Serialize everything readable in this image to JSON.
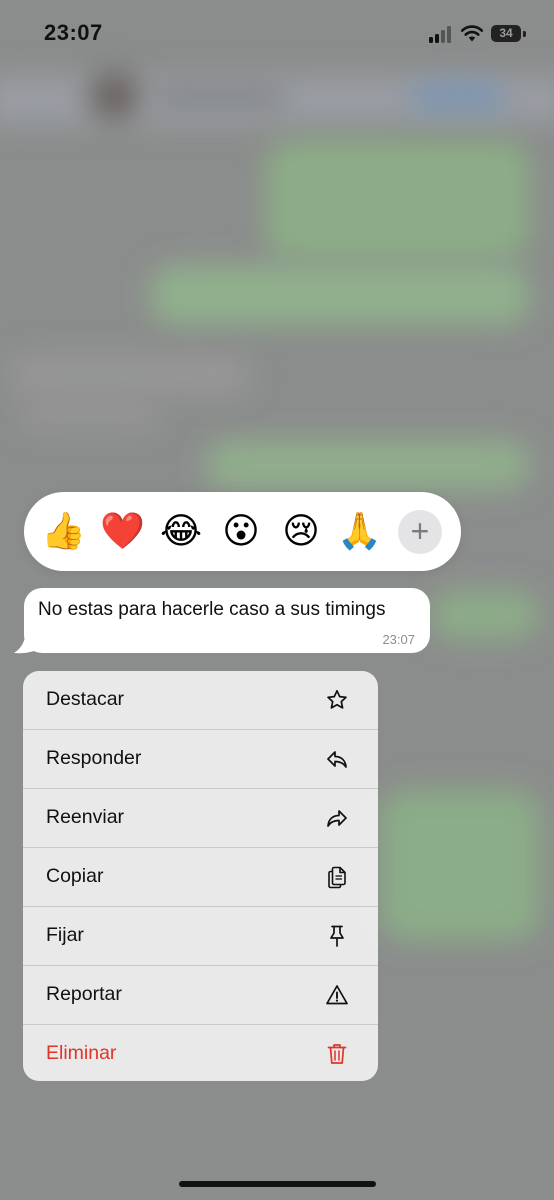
{
  "status_bar": {
    "time": "23:07",
    "battery_level": "34"
  },
  "reactions": [
    {
      "name": "thumbs-up-emoji",
      "glyph": "👍"
    },
    {
      "name": "red-heart-emoji",
      "glyph": "❤️"
    },
    {
      "name": "tears-of-joy-emoji",
      "glyph": "😂"
    },
    {
      "name": "astonished-face-emoji",
      "glyph": "😮"
    },
    {
      "name": "crying-face-emoji",
      "glyph": "😢"
    },
    {
      "name": "folded-hands-emoji",
      "glyph": "🙏"
    }
  ],
  "reaction_more": {
    "glyph": "+",
    "icon": "plus-icon"
  },
  "message": {
    "text": "No estas para hacerle caso a sus timings",
    "time": "23:07"
  },
  "menu": {
    "items": [
      {
        "label": "Destacar",
        "icon": "star-icon"
      },
      {
        "label": "Responder",
        "icon": "reply-icon"
      },
      {
        "label": "Reenviar",
        "icon": "forward-icon"
      },
      {
        "label": "Copiar",
        "icon": "copy-icon"
      },
      {
        "label": "Fijar",
        "icon": "pin-icon"
      },
      {
        "label": "Reportar",
        "icon": "warning-icon"
      },
      {
        "label": "Eliminar",
        "icon": "trash-icon",
        "danger": true
      }
    ]
  },
  "colors": {
    "danger": "#e0352b",
    "bubble": "#ffffff",
    "menu_background": "#ececec"
  }
}
